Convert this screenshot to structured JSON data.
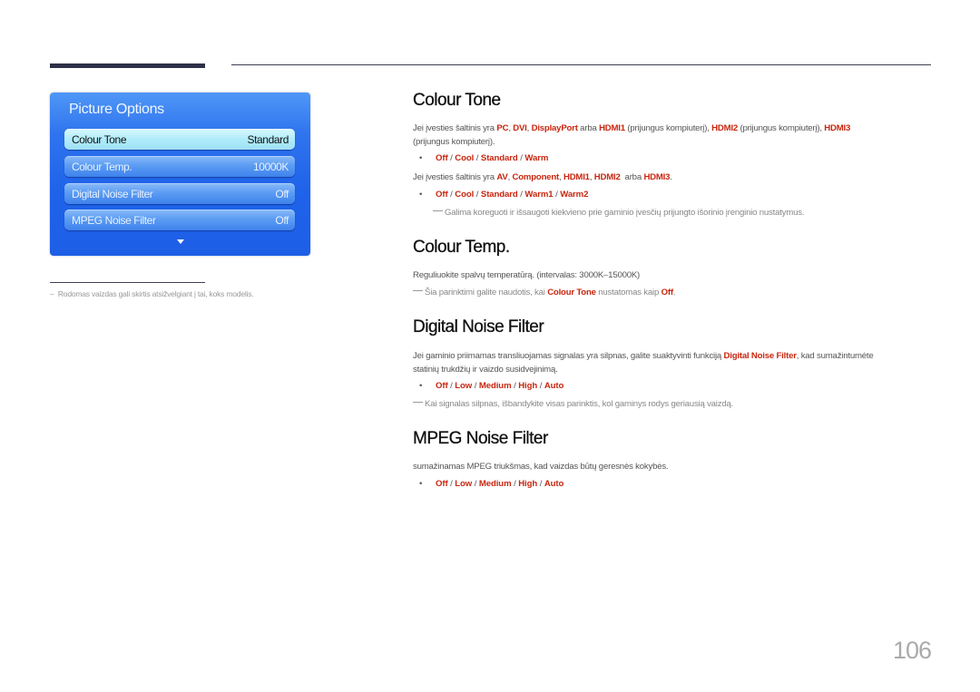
{
  "osd": {
    "title": "Picture Options",
    "items": [
      {
        "label": "Colour Tone",
        "value": "Standard",
        "selected": true
      },
      {
        "label": "Colour Temp.",
        "value": "10000K",
        "selected": false
      },
      {
        "label": "Digital Noise Filter",
        "value": "Off",
        "selected": false
      },
      {
        "label": "MPEG Noise Filter",
        "value": "Off",
        "selected": false
      }
    ],
    "more_icon": "triangle-down-icon"
  },
  "footnote": "Rodomas vaizdas gali skirtis atsižvelgiant į tai, koks modelis.",
  "footnote_dash": "–",
  "colour_tone": {
    "title": "Colour Tone",
    "p1": {
      "t1": "Jei įvesties šaltinis yra ",
      "pc": "PC",
      "sep1": ", ",
      "dvi": "DVI",
      "sep2": ", ",
      "dp": "DisplayPort",
      "t2": " arba ",
      "hdmi1": "HDMI1",
      "t3": " (prijungus kompiuterį), ",
      "hdmi2": "HDMI2",
      "t4": " (prijungus kompiuterį), ",
      "hdmi3": "HDMI3",
      "t5": "(prijungus kompiuterį)."
    },
    "options1": [
      "Off",
      "Cool",
      "Standard",
      "Warm"
    ],
    "p2": {
      "t1": "Jei įvesties šaltinis yra ",
      "av": "AV",
      "sep1": ", ",
      "comp": "Component",
      "sep2": ", ",
      "hdmi1": "HDMI1",
      "sep3": ", ",
      "hdmi2": "HDMI2",
      "t2": "  arba ",
      "hdmi3": "HDMI3",
      "t3": "."
    },
    "options2": [
      "Off",
      "Cool",
      "Standard",
      "Warm1",
      "Warm2"
    ],
    "note": "Galima koreguoti ir išsaugoti kiekvieno prie gaminio įvesčių prijungto išorinio įrenginio nustatymus."
  },
  "colour_temp": {
    "title": "Colour Temp.",
    "p1": "Reguliuokite spalvų temperatūrą. (intervalas: 3000K–15000K)",
    "note": {
      "t1": "Šia parinktimi galite naudotis, kai ",
      "hl1": "Colour Tone",
      "t2": " nustatomas kaip ",
      "hl2": "Off",
      "t3": "."
    }
  },
  "dnf": {
    "title": "Digital Noise Filter",
    "p1": {
      "t1": "Jei gaminio priimamas transliuojamas signalas yra silpnas, galite suaktyvinti funkciją ",
      "hl": "Digital Noise Filter",
      "t2": ", kad sumažintumėte",
      "t3": "statinių trukdžių ir vaizdo susidvejinimą."
    },
    "options": [
      "Off",
      "Low",
      "Medium",
      "High",
      "Auto"
    ],
    "note": "Kai signalas silpnas, išbandykite visas parinktis, kol gaminys rodys geriausią vaizdą."
  },
  "mpeg": {
    "title": "MPEG Noise Filter",
    "p1": "sumažinamas MPEG triukšmas, kad vaizdas būtų geresnės kokybės.",
    "options": [
      "Off",
      "Low",
      "Medium",
      "High",
      "Auto"
    ]
  },
  "bullet": "•",
  "slash": " / ",
  "page_number": "106",
  "colors": {
    "accent": "#c8260f",
    "osd_blue": "#1f63ea",
    "osd_selected": "#b0ecfa"
  }
}
